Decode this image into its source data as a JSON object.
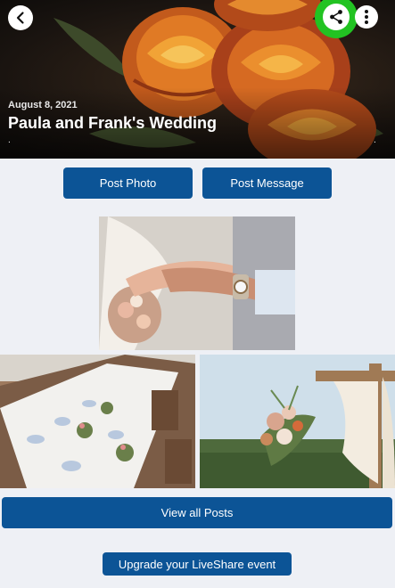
{
  "event": {
    "date": "August 8, 2021",
    "title": "Paula and Frank's Wedding",
    "dot_left": ".",
    "dot_right": "."
  },
  "toolbar": {
    "back_icon": "chevron-left-icon",
    "share_icon": "share-icon",
    "more_icon": "more-vertical-icon",
    "share_highlight_color": "#22c322"
  },
  "actions": {
    "post_photo_label": "Post Photo",
    "post_message_label": "Post Message"
  },
  "posts": {
    "view_all_label": "View all Posts",
    "photos": [
      "wedding-rings-photo",
      "table-setting-photo",
      "floral-arch-photo"
    ]
  },
  "footer": {
    "upgrade_label": "Upgrade your LiveShare event"
  },
  "colors": {
    "primary": "#0c5496",
    "background": "#eef0f5"
  }
}
